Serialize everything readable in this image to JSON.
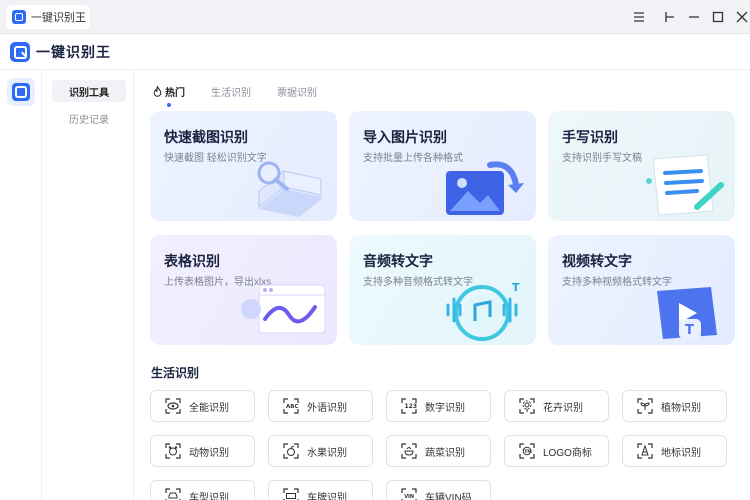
{
  "window": {
    "tab_title": "一键识别王"
  },
  "app": {
    "name": "一键识别王"
  },
  "subnav": {
    "items": [
      {
        "label": "识别工具",
        "active": true
      },
      {
        "label": "历史记录",
        "active": false
      }
    ]
  },
  "tabs": [
    {
      "label": "热门",
      "active": true
    },
    {
      "label": "生活识别",
      "active": false
    },
    {
      "label": "票据识别",
      "active": false
    }
  ],
  "cards": [
    {
      "title": "快速截图识别",
      "subtitle": "快速截图 轻松识别文字"
    },
    {
      "title": "导入图片识别",
      "subtitle": "支持批量上传各种格式"
    },
    {
      "title": "手写识别",
      "subtitle": "支持识别手写文稿"
    },
    {
      "title": "表格识别",
      "subtitle": "上传表格图片，导出xlxs"
    },
    {
      "title": "音频转文字",
      "subtitle": "支持多种音频格式转文字"
    },
    {
      "title": "视频转文字",
      "subtitle": "支持多种视频格式转文字"
    }
  ],
  "life": {
    "title": "生活识别",
    "tools": [
      {
        "label": "全能识别",
        "icon": "eye-scan-icon"
      },
      {
        "label": "外语识别",
        "icon": "abc-scan-icon"
      },
      {
        "label": "数字识别",
        "icon": "number-scan-icon"
      },
      {
        "label": "花卉识别",
        "icon": "flower-scan-icon"
      },
      {
        "label": "植物识别",
        "icon": "plant-scan-icon"
      },
      {
        "label": "动物识别",
        "icon": "animal-scan-icon"
      },
      {
        "label": "水果识别",
        "icon": "fruit-scan-icon"
      },
      {
        "label": "蔬菜识别",
        "icon": "vegetable-scan-icon"
      },
      {
        "label": "LOGO商标",
        "icon": "logo-scan-icon"
      },
      {
        "label": "地标识别",
        "icon": "landmark-scan-icon"
      },
      {
        "label": "车型识别",
        "icon": "car-scan-icon"
      },
      {
        "label": "车牌识别",
        "icon": "plate-scan-icon"
      },
      {
        "label": "车辆VIN码",
        "icon": "vin-scan-icon"
      }
    ]
  },
  "colors": {
    "accent": "#2f6cf6",
    "card_bg": "#eef3ff"
  }
}
